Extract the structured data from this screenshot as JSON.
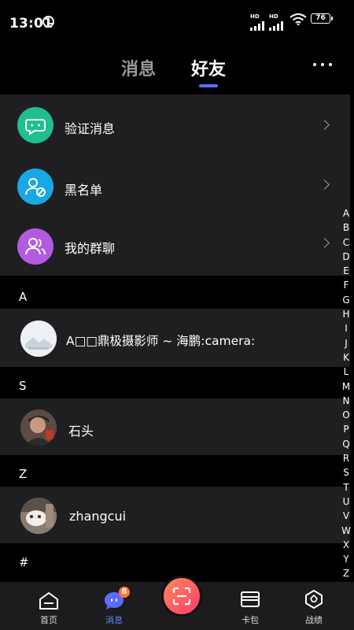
{
  "status": {
    "time": "13:01",
    "battery": "76",
    "hd1": "HD",
    "hd2": "HD"
  },
  "tabs": {
    "messages": "消息",
    "friends": "好友"
  },
  "menu": [
    {
      "label": "验证消息",
      "color": "#1fbf8f"
    },
    {
      "label": "黑名单",
      "color": "#17a8e6"
    },
    {
      "label": "我的群聊",
      "color": "#b35be0"
    }
  ],
  "sections": [
    {
      "letter": "A",
      "contact": "A□□鼎极摄影师 ~ 海鹏:camera:"
    },
    {
      "letter": "S",
      "contact": "石头"
    },
    {
      "letter": "Z",
      "contact": "zhangcui"
    },
    {
      "letter": "#"
    }
  ],
  "alphabet": [
    "A",
    "B",
    "C",
    "D",
    "E",
    "F",
    "G",
    "H",
    "I",
    "J",
    "K",
    "L",
    "M",
    "N",
    "O",
    "P",
    "Q",
    "R",
    "S",
    "T",
    "U",
    "V",
    "W",
    "X",
    "Y",
    "Z"
  ],
  "nav": {
    "home": "首页",
    "messages": "消息",
    "messages_badge": "8",
    "wallet": "卡包",
    "records": "战绩"
  },
  "colors": {
    "accent": "#5b6cff",
    "fab_gradient_start": "#ff8a5b",
    "fab_gradient_end": "#ff3b6b"
  }
}
